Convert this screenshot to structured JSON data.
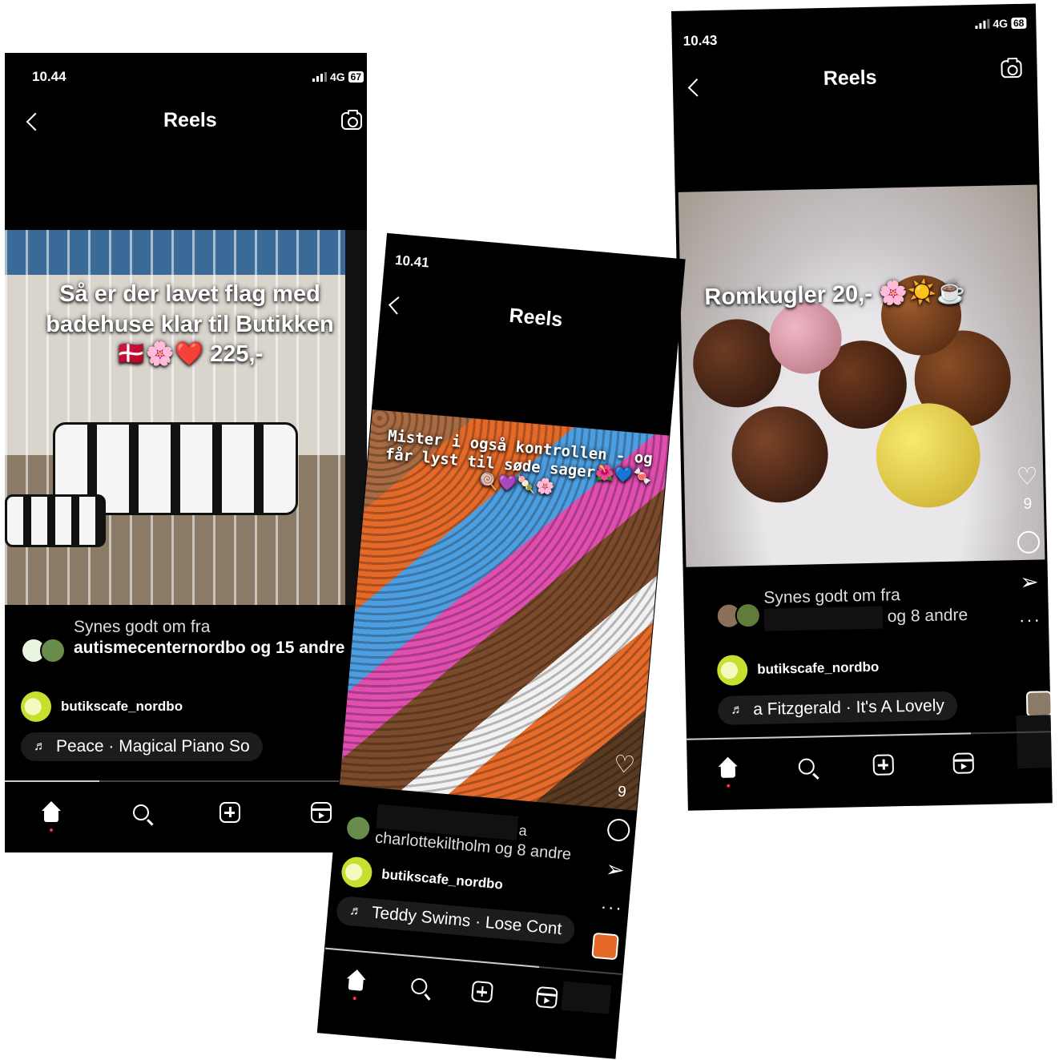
{
  "phones": [
    {
      "time": "10.44",
      "network": "4G",
      "battery": "67",
      "title": "Reels",
      "overlay_text": "Så er der lavet flag med badehuse klar til Butikken 🇩🇰🌸❤️ 225,-",
      "likes_prefix": "Synes godt om fra",
      "likes_user": "autismecenternordbo",
      "likes_suffix": "og 15 andre",
      "username": "butikscafe_nordbo",
      "music": "Peace · Magical Piano So"
    },
    {
      "time": "10.41",
      "title": "Reels",
      "overlay_text": "Mister i også kontrollen - og får lyst til søde sager🌺💙🍬🍭💜🍡🌸",
      "like_count": "9",
      "likes_line1_suffix": "a",
      "likes_line2": "charlottekiltholm og 8 andre",
      "username": "butikscafe_nordbo",
      "music": "Teddy Swims · Lose Cont"
    },
    {
      "time": "10.43",
      "network": "4G",
      "battery": "68",
      "title": "Reels",
      "overlay_text": "Romkugler 20,- 🌸☀️☕",
      "like_count": "9",
      "likes_prefix": "Synes godt om fra",
      "likes_suffix": "og 8 andre",
      "username": "butikscafe_nordbo",
      "music": "a Fitzgerald · It's A Lovely"
    }
  ]
}
